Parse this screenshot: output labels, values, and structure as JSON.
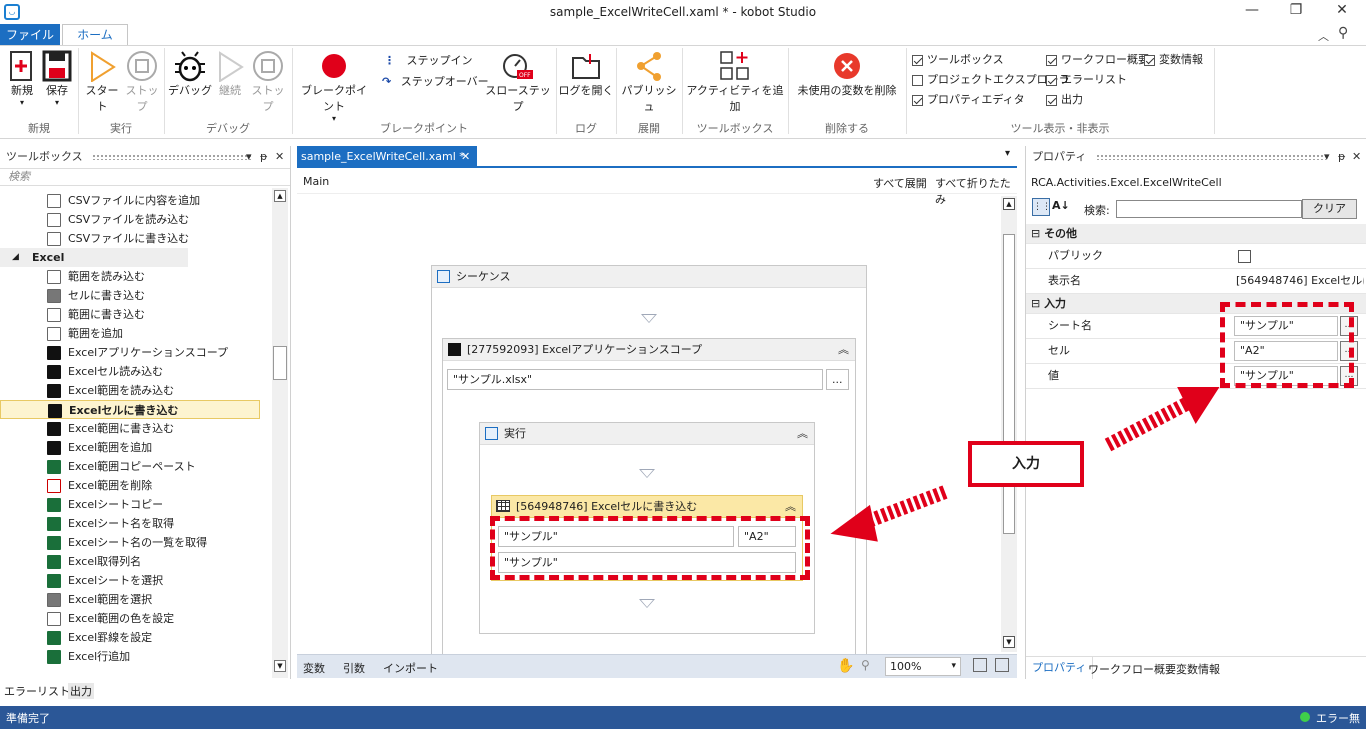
{
  "window": {
    "title": "sample_ExcelWriteCell.xaml * - kobot Studio"
  },
  "tabs": {
    "file": "ファイル",
    "home": "ホーム"
  },
  "ribbon": {
    "new": "新規",
    "save": "保存",
    "start": "スタート",
    "stop": "ストップ",
    "debug": "デバッグ",
    "continue": "継続",
    "stop2": "ストップ",
    "breakpoint": "ブレークポイント",
    "step_in": "ステップイン",
    "step_over": "ステップオーバー",
    "slow_step": "スローステップ",
    "open_log": "ログを開く",
    "publish": "パブリッシュ",
    "add_activity": "アクティビティを追加",
    "delete_unused": "未使用の変数を削除",
    "chk": {
      "toolbox": "ツールボックス",
      "project_explorer": "プロジェクトエクスプローラ",
      "property_editor": "プロパティエディタ",
      "workflow_overview": "ワークフロー概要",
      "error_list": "エラーリスト",
      "output": "出力",
      "variable_info": "変数情報"
    },
    "groups": {
      "new": "新規",
      "run": "実行",
      "debug": "デバッグ",
      "breakpoint": "ブレークポイント",
      "log": "ログ",
      "deploy": "展開",
      "toolbox": "ツールボックス",
      "delete": "削除する",
      "toggle": "ツール表示・非表示"
    }
  },
  "toolbox": {
    "header": "ツールボックス",
    "search_placeholder": "検索",
    "items": [
      {
        "label": "CSVファイルに内容を追加",
        "icon": "doc"
      },
      {
        "label": "CSVファイルを読み込む",
        "icon": "doc"
      },
      {
        "label": "CSVファイルに書き込む",
        "icon": "doc"
      }
    ],
    "category": "Excel",
    "excel_items": [
      {
        "label": "範囲を読み込む",
        "icon": "doc"
      },
      {
        "label": "セルに書き込む",
        "icon": "grid"
      },
      {
        "label": "範囲に書き込む",
        "icon": "doc"
      },
      {
        "label": "範囲を追加",
        "icon": "doc"
      },
      {
        "label": "Excelアプリケーションスコープ",
        "icon": "black"
      },
      {
        "label": "Excelセル読み込む",
        "icon": "black"
      },
      {
        "label": "Excel範囲を読み込む",
        "icon": "black"
      },
      {
        "label": "Excelセルに書き込む",
        "icon": "black"
      },
      {
        "label": "Excel範囲に書き込む",
        "icon": "black"
      },
      {
        "label": "Excel範囲を追加",
        "icon": "black"
      },
      {
        "label": "Excel範囲コピーペースト",
        "icon": "green"
      },
      {
        "label": "Excel範囲を削除",
        "icon": "red"
      },
      {
        "label": "Excelシートコピー",
        "icon": "green"
      },
      {
        "label": "Excelシート名を取得",
        "icon": "green"
      },
      {
        "label": "Excelシート名の一覧を取得",
        "icon": "green"
      },
      {
        "label": "Excel取得列名",
        "icon": "green"
      },
      {
        "label": "Excelシートを選択",
        "icon": "green"
      },
      {
        "label": "Excel範囲を選択",
        "icon": "grid"
      },
      {
        "label": "Excel範囲の色を設定",
        "icon": "doc"
      },
      {
        "label": "Excel罫線を設定",
        "icon": "green"
      },
      {
        "label": "Excel行追加",
        "icon": "green"
      }
    ]
  },
  "bottom_tabs": {
    "error_list": "エラーリスト",
    "output": "出力"
  },
  "designer": {
    "tab": "sample_ExcelWriteCell.xaml *",
    "breadcrumb": "Main",
    "expand_all": "すべて展開",
    "collapse_all": "すべて折りたたみ",
    "sequence": "シーケンス",
    "scope": "[277592093] Excelアプリケーションスコープ",
    "scope_file": "\"サンプル.xlsx\"",
    "exec": "実行",
    "write_cell": "[564948746] Excelセルに書き込む",
    "sheet_value": "\"サンプル\"",
    "cell_value": "\"A2\"",
    "value_value": "\"サンプル\"",
    "footer": {
      "variables": "変数",
      "arguments": "引数",
      "imports": "インポート",
      "zoom": "100%"
    }
  },
  "properties": {
    "header": "プロパティ",
    "type": "RCA.Activities.Excel.ExcelWriteCell",
    "search_label": "検索:",
    "clear": "クリア",
    "cat_other": "その他",
    "public": "パブリック",
    "display_name": "表示名",
    "display_name_value": "[564948746] Excelセルに",
    "cat_input": "入力",
    "sheet": "シート名",
    "sheet_value": "\"サンプル\"",
    "cell": "セル",
    "cell_value": "\"A2\"",
    "value": "値",
    "value_value": "\"サンプル\"",
    "tabs": {
      "properties": "プロパティ",
      "workflow_overview": "ワークフロー概要",
      "variable_info": "変数情報"
    }
  },
  "annotation": {
    "label": "入力",
    "color": "#e0001a"
  },
  "status": {
    "left": "準備完了",
    "right": "エラー無し",
    "bar_color": "#2b5797"
  }
}
